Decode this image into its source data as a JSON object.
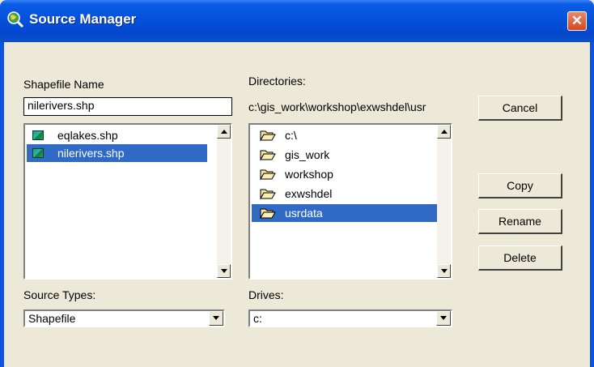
{
  "window": {
    "title": "Source Manager",
    "close_symbol": "✕"
  },
  "shapefile": {
    "label": "Shapefile Name",
    "value": "nilerivers.shp",
    "files": [
      {
        "name": "eqlakes.shp",
        "selected": false,
        "icon": "shapefile-icon"
      },
      {
        "name": "nilerivers.shp",
        "selected": true,
        "icon": "shapefile-icon"
      }
    ]
  },
  "directories": {
    "label": "Directories:",
    "path": "c:\\gis_work\\workshop\\exwshdel\\usr",
    "items": [
      {
        "name": "c:\\",
        "selected": false,
        "icon": "open-folder-icon"
      },
      {
        "name": "gis_work",
        "selected": false,
        "icon": "open-folder-icon"
      },
      {
        "name": "workshop",
        "selected": false,
        "icon": "open-folder-icon"
      },
      {
        "name": "exwshdel",
        "selected": false,
        "icon": "open-folder-icon"
      },
      {
        "name": "usrdata",
        "selected": true,
        "icon": "open-folder-icon"
      }
    ]
  },
  "source_types": {
    "label": "Source Types:",
    "value": "Shapefile"
  },
  "drives": {
    "label": "Drives:",
    "value": "c:"
  },
  "buttons": {
    "cancel": "Cancel",
    "copy": "Copy",
    "rename": "Rename",
    "delete": "Delete"
  },
  "colors": {
    "titlebar": "#0a54e0",
    "selection": "#316ac5",
    "dialog_bg": "#ece9d8",
    "close": "#d6481e"
  }
}
